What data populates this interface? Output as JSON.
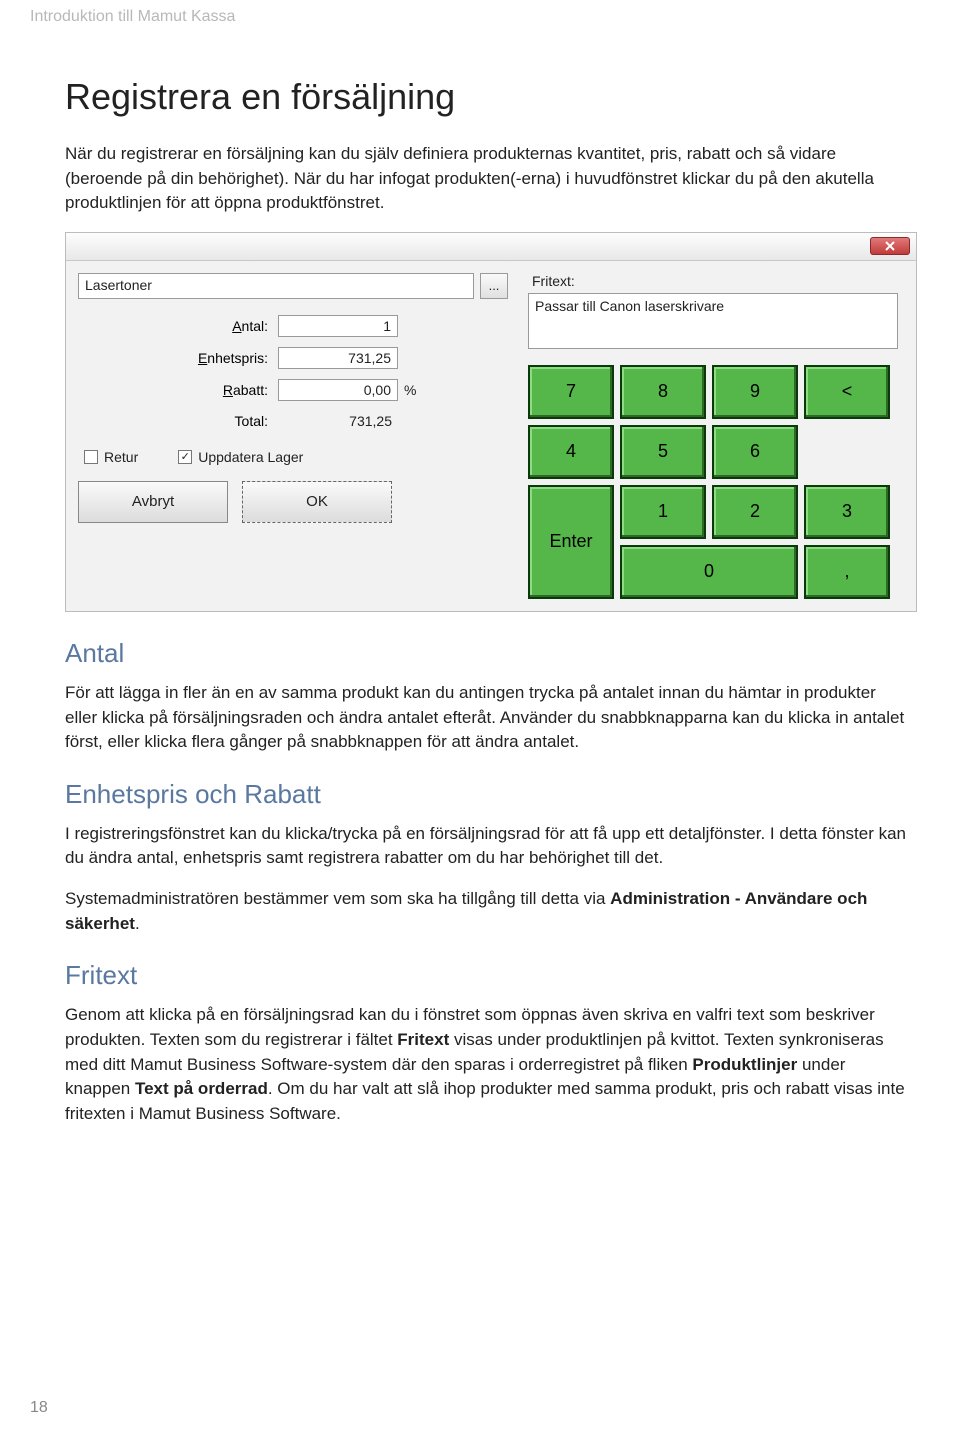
{
  "header": "Introduktion till Mamut Kassa",
  "title": "Registrera en försäljning",
  "intro_p1": "När du registrerar en försäljning kan du själv definiera produkternas kvantitet, pris, rabatt och så vidare (beroende på din behörighet). När du har infogat produkten(-erna) i huvudfönstret klickar du på den akutella produktlinjen för att öppna produktfönstret.",
  "dialog": {
    "product_name": "Lasertoner",
    "fritext_label": "Fritext:",
    "fritext_value": "Passar till Canon laserskrivare",
    "labels": {
      "antal": "Antal:",
      "enhetspris": "Enhetspris:",
      "rabatt": "Rabatt:",
      "total": "Total:",
      "percent": "%"
    },
    "values": {
      "antal": "1",
      "enhetspris": "731,25",
      "rabatt": "0,00",
      "total": "731,25"
    },
    "checks": {
      "retur": "Retur",
      "uppdatera": "Uppdatera Lager",
      "uppdatera_checked": "✓"
    },
    "buttons": {
      "avbryt": "Avbryt",
      "ok": "OK"
    },
    "keypad": {
      "k7": "7",
      "k8": "8",
      "k9": "9",
      "back": "<",
      "k4": "4",
      "k5": "5",
      "k6": "6",
      "k1": "1",
      "k2": "2",
      "k3": "3",
      "enter": "Enter",
      "k0": "0",
      "comma": ","
    },
    "ellipsis": "..."
  },
  "sections": {
    "antal_h": "Antal",
    "antal_p": "För att lägga in fler än en av samma produkt kan du antingen trycka på antalet innan du hämtar in produkter eller klicka på försäljningsraden och ändra antalet efteråt. Använder du snabbknapparna kan du klicka in antalet först, eller klicka flera gånger på snabbknappen för att ändra antalet.",
    "enh_h": "Enhetspris och Rabatt",
    "enh_p1": "I registreringsfönstret kan du klicka/trycka på en försäljningsrad för att få upp ett detaljfönster. I detta fönster kan du ändra antal, enhetspris samt registrera rabatter om du har behörighet till det.",
    "enh_p2_a": "Systemadministratören bestämmer vem som ska ha tillgång till detta via ",
    "enh_p2_b": "Administration - Användare och säkerhet",
    "enh_p2_c": ".",
    "fri_h": "Fritext",
    "fri_p_a": "Genom att klicka på en försäljningsrad kan du i fönstret som öppnas även skriva en valfri text som beskriver produkten. Texten som du registrerar i fältet ",
    "fri_p_b": "Fritext",
    "fri_p_c": " visas under produktlinjen på kvittot. Texten synkroniseras med ditt Mamut Business Software-system där den sparas i orderregistret på fliken ",
    "fri_p_d": "Produktlinjer",
    "fri_p_e": " under knappen ",
    "fri_p_f": "Text på orderrad",
    "fri_p_g": ". Om du har valt att slå ihop produkter med samma produkt, pris och rabatt visas inte fritexten i Mamut Business Software."
  },
  "page_number": "18"
}
